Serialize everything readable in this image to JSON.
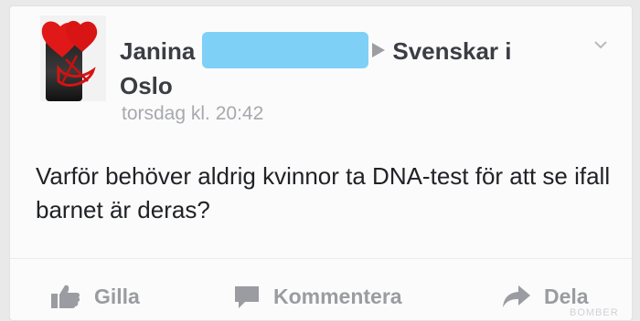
{
  "post": {
    "author_first": "Janina",
    "group": "Svenskar i",
    "group_cont": "Oslo",
    "timestamp": "torsdag kl. 20:42",
    "text": "Varför behöver aldrig kvinnor ta DNA-test för att se ifall barnet är deras?"
  },
  "actions": {
    "like": "Gilla",
    "comment": "Kommentera",
    "share": "Dela"
  },
  "colors": {
    "redaction": "#7ed0f7",
    "heart": "#e01818"
  },
  "watermark": "BOMBER"
}
